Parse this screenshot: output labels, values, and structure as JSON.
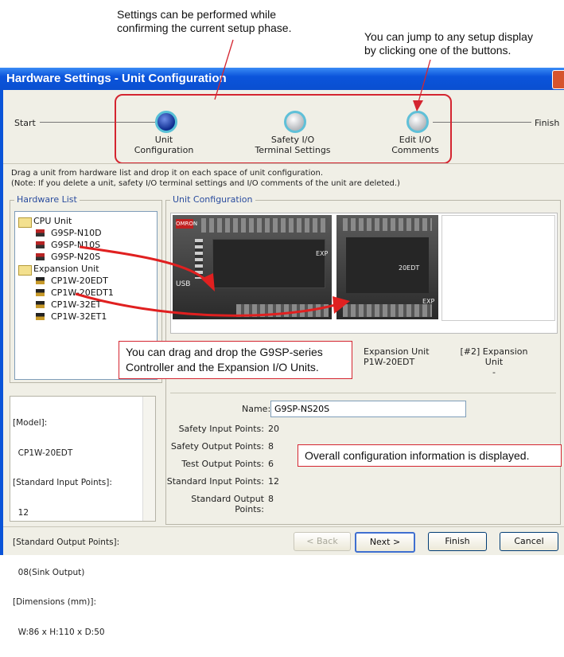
{
  "annotations": {
    "phase_note": [
      "Settings can be performed while",
      "confirming the current setup phase."
    ],
    "jump_note": [
      "You can jump to any setup display",
      "by clicking one of the buttons."
    ],
    "drag_note": [
      "You can drag and drop the G9SP-series",
      "Controller and the Expansion I/O Units."
    ],
    "overall_note": "Overall configuration information is displayed."
  },
  "window": {
    "title": "Hardware Settings - Unit Configuration"
  },
  "wizard": {
    "start": "Start",
    "finish": "Finish",
    "steps": [
      {
        "label": [
          "Unit",
          "Configuration"
        ]
      },
      {
        "label": [
          "Safety I/O",
          "Terminal Settings"
        ]
      },
      {
        "label": [
          "Edit I/O",
          "Comments"
        ]
      }
    ]
  },
  "instructions": [
    "Drag a unit from hardware list and drop it on each space of unit configuration.",
    "(Note: If you delete a unit, safety I/O terminal settings and I/O comments of the unit are deleted.)"
  ],
  "hardware_list": {
    "title": "Hardware List",
    "groups": [
      {
        "label": "CPU Unit",
        "items": [
          "G9SP-N10D",
          "G9SP-N10S",
          "G9SP-N20S"
        ]
      },
      {
        "label": "Expansion Unit",
        "items": [
          "CP1W-20EDT",
          "CP1W-20EDT1",
          "CP1W-32ET",
          "CP1W-32ET1"
        ]
      }
    ]
  },
  "details": [
    "[Model]:",
    "  CP1W-20EDT",
    "[Standard Input Points]:",
    "  12",
    "[Standard Output Points]:",
    "  08(Sink Output)",
    "[Dimensions (mm)]:",
    "  W:86 x H:110 x D:50"
  ],
  "unit_configuration": {
    "title": "Unit Configuration",
    "slot1_label": [
      "Expansion Unit",
      "P1W-20EDT"
    ],
    "slot2_label": [
      "[#2] Expansion Unit",
      "-"
    ],
    "device_text": {
      "usb": "USB",
      "exp": "EXP",
      "exp2": "EXP",
      "model": "20EDT",
      "brand": "OMRON"
    }
  },
  "info": {
    "name_label": "Name:",
    "name_value": "G9SP-NS20S",
    "rows": [
      {
        "label": "Safety Input Points:",
        "value": "20"
      },
      {
        "label": "Safety Output Points:",
        "value": "8"
      },
      {
        "label": "Test Output Points:",
        "value": "6"
      },
      {
        "label": "Standard Input Points:",
        "value": "12"
      },
      {
        "label": "Standard Output Points:",
        "value": "8"
      }
    ]
  },
  "buttons": {
    "back": "< Back",
    "next": "Next >",
    "finish": "Finish",
    "cancel": "Cancel"
  }
}
